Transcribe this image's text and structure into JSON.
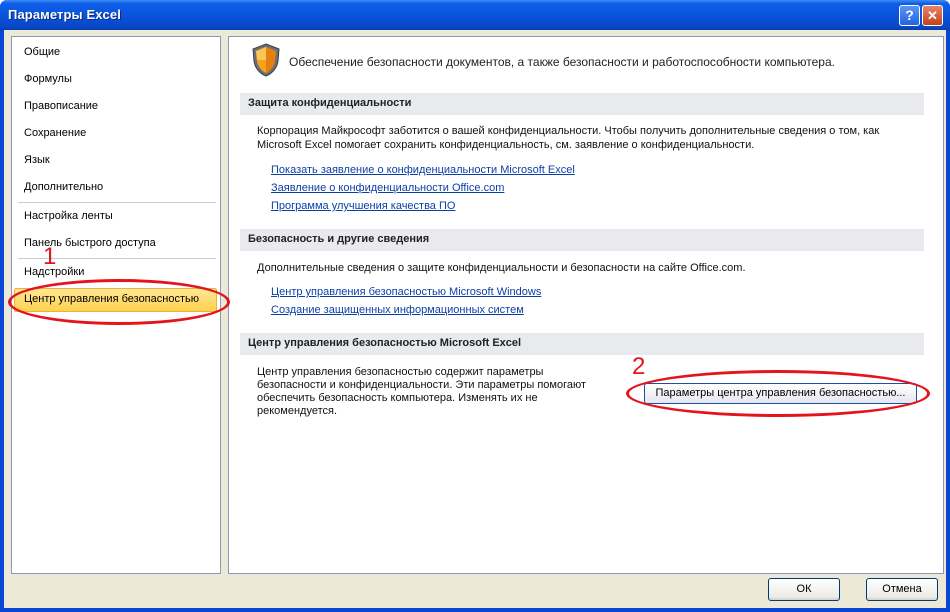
{
  "window": {
    "title": "Параметры Excel"
  },
  "sidebar": {
    "items": [
      {
        "label": "Общие"
      },
      {
        "label": "Формулы"
      },
      {
        "label": "Правописание"
      },
      {
        "label": "Сохранение"
      },
      {
        "label": "Язык"
      },
      {
        "label": "Дополнительно"
      },
      {
        "label": "Настройка ленты"
      },
      {
        "label": "Панель быстрого доступа"
      },
      {
        "label": "Надстройки"
      },
      {
        "label": "Центр управления безопасностью",
        "selected": true
      }
    ]
  },
  "main": {
    "header": "Обеспечение безопасности документов, а также безопасности и работоспособности компьютера.",
    "sections": [
      {
        "title": "Защита конфиденциальности",
        "text_lines": [
          "Корпорация Майкрософт заботится о вашей конфиденциальности. Чтобы получить дополнительные сведения о том, как",
          "Microsoft Excel помогает сохранить конфиденциальность, см. заявление о конфиденциальности."
        ],
        "links": [
          "Показать заявление о конфиденциальности Microsoft Excel",
          "Заявление о конфиденциальности Office.com",
          "Программа улучшения качества ПО"
        ]
      },
      {
        "title": "Безопасность и другие сведения",
        "text_lines": [
          "Дополнительные сведения о защите конфиденциальности и безопасности на сайте Office.com."
        ],
        "links": [
          "Центр управления безопасностью Microsoft Windows",
          "Создание защищенных информационных систем"
        ]
      },
      {
        "title": "Центр управления безопасностью Microsoft Excel",
        "text_lines": [
          "Центр управления безопасностью содержит параметры",
          "безопасности и конфиденциальности. Эти параметры помогают",
          "обеспечить безопасность компьютера. Изменять их не",
          "рекомендуется."
        ],
        "button_label": "Параметры центра управления безопасностью..."
      }
    ]
  },
  "annotations": {
    "marker_1": "1",
    "marker_2": "2",
    "color": "#e3141b"
  },
  "footer": {
    "ok_label": "ОК",
    "cancel_label": "Отмена"
  }
}
